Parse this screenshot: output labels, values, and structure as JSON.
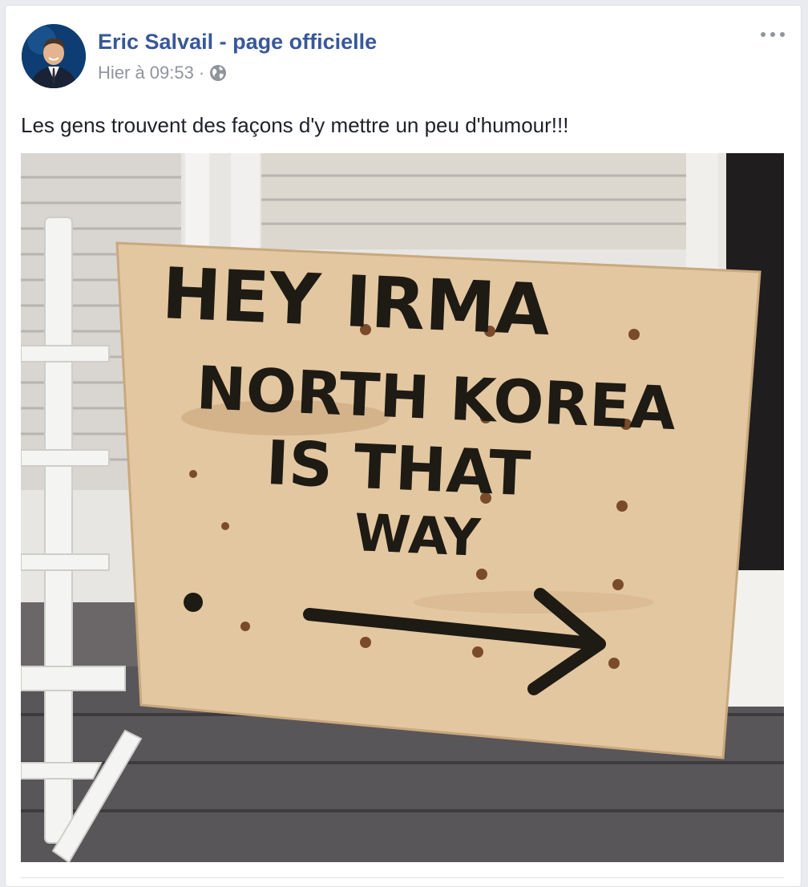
{
  "post": {
    "author_name": "Eric Salvail - page officielle",
    "timestamp": "Hier à 09:53",
    "separator": "·",
    "privacy_icon": "globe-icon",
    "options_icon": "more-options-icon",
    "message": "Les gens trouvent des façons d'y mettre un peu d'humour!!!"
  },
  "photo": {
    "sign_lines": [
      "HEY IRMA",
      "NORTH KOREA",
      "IS THAT",
      "WAY"
    ],
    "arrow_icon": "right-arrow-icon"
  },
  "colors": {
    "link": "#385898",
    "meta": "#90949c",
    "text": "#1d2129",
    "background": "#e9ebee"
  }
}
